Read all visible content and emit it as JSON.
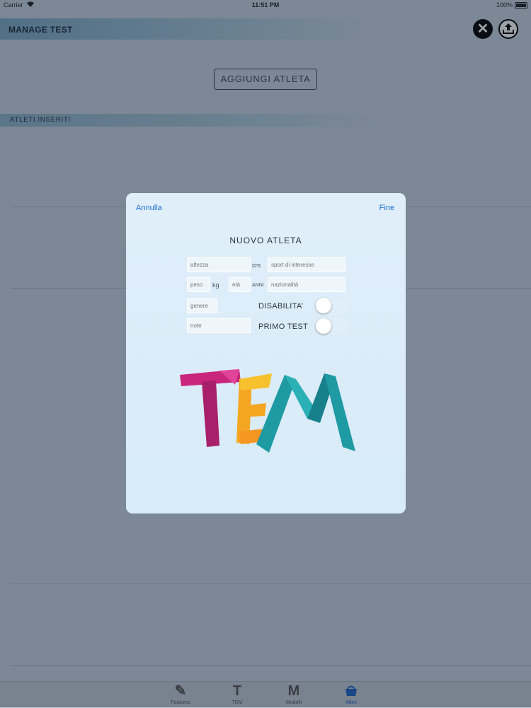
{
  "status_bar": {
    "carrier": "Carrier",
    "time": "11:51 PM",
    "battery": "100%"
  },
  "header": {
    "title": "MANAGE TEST"
  },
  "main": {
    "add_button": "AGGIUNGI ATLETA",
    "section_title": "ATLETI INSERITI"
  },
  "modal": {
    "cancel": "Annulla",
    "done": "Fine",
    "title": "NUOVO ATLETA",
    "fields": {
      "height": "altezza",
      "sport": "sport di interesse",
      "weight": "peso",
      "age": "età",
      "nationality": "nazionalità",
      "gender": "genere",
      "notes": "note"
    },
    "units": {
      "cm": "cm",
      "kg": "kg",
      "years": "ANNI"
    },
    "toggles": [
      {
        "label": "DISABILITA’",
        "on": false
      },
      {
        "label": "PRIMO TEST",
        "on": false
      }
    ],
    "logo_text": "TEM"
  },
  "tabbar": {
    "tabs": [
      {
        "label": "Features",
        "icon": "pencil-icon",
        "active": false
      },
      {
        "label": "TEM",
        "icon": "t-icon",
        "active": false
      },
      {
        "label": "Modelli",
        "icon": "m-icon",
        "active": false
      },
      {
        "label": "Atleti",
        "icon": "basket-icon",
        "active": true
      }
    ]
  },
  "colors": {
    "accent": "#1d6fd2",
    "active_tab": "#1d63c8",
    "logo_magenta": "#c8267c",
    "logo_yellow": "#f5a623",
    "logo_teal": "#1e9aa3"
  }
}
